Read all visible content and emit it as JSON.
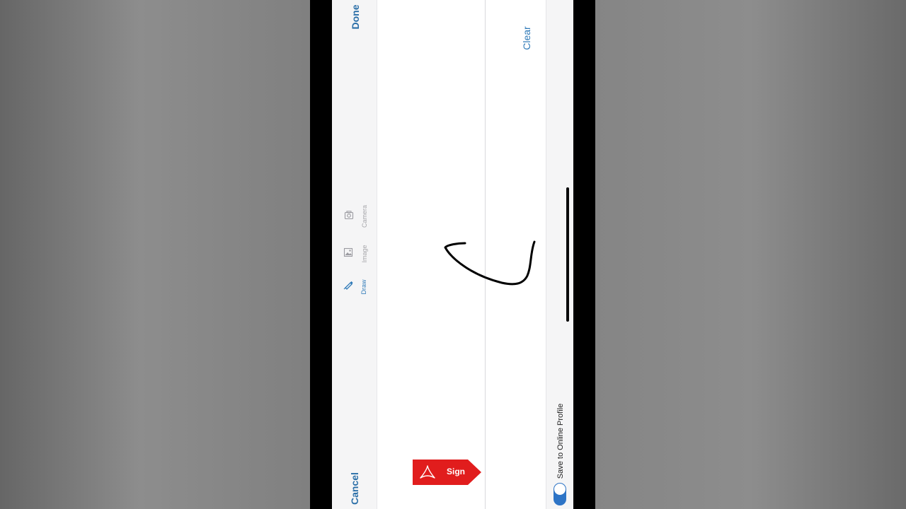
{
  "header": {
    "done_label": "Done",
    "cancel_label": "Cancel"
  },
  "tools": [
    {
      "label": "Draw",
      "icon": "pen-icon",
      "active": true
    },
    {
      "label": "Image",
      "icon": "image-icon",
      "active": false
    },
    {
      "label": "Camera",
      "icon": "camera-icon",
      "active": false
    }
  ],
  "canvas": {
    "clear_label": "Clear"
  },
  "branding": {
    "sign_label": "Sign",
    "logo_icon": "acrobat-logo-icon",
    "tag_color": "#e11d1d"
  },
  "footer": {
    "save_online_label": "Save to Online Profile",
    "save_online_enabled": true
  },
  "colors": {
    "accent": "#2f7ab8",
    "toggle": "#2d74c6"
  }
}
